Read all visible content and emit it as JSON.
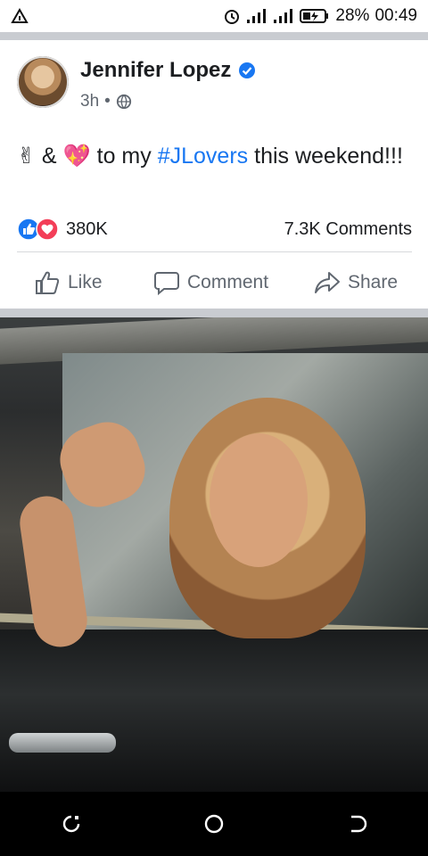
{
  "status_bar": {
    "left_icon": "navigation-arrow-icon",
    "right_icons": [
      "alarm-icon",
      "signal-icon",
      "signal-icon",
      "battery-charging-icon"
    ],
    "battery": "28%",
    "time": "00:49"
  },
  "post": {
    "author": "Jennifer Lopez",
    "verified_icon": "verified-badge-icon",
    "time": "3h",
    "audience_icon": "globe-icon",
    "text": {
      "emoji_1": "✌",
      "amp": "&",
      "emoji_2": "💖",
      "before_tag": "to my",
      "hashtag": "#JLovers",
      "after_tag": "this weekend!!!"
    },
    "reactions": {
      "icons": [
        "like-icon",
        "love-icon"
      ],
      "count": "380K",
      "comments": "7.3K Comments"
    },
    "actions": {
      "like": "Like",
      "comment": "Comment",
      "share": "Share"
    },
    "photo_alt_icon": "photo"
  },
  "colors": {
    "accent": "#1877f2",
    "love": "#f33e58",
    "muted": "#606770",
    "separator": "#c9ccd1"
  },
  "nav_bar": {
    "buttons": [
      "recent-apps-icon",
      "home-icon",
      "back-icon"
    ]
  }
}
